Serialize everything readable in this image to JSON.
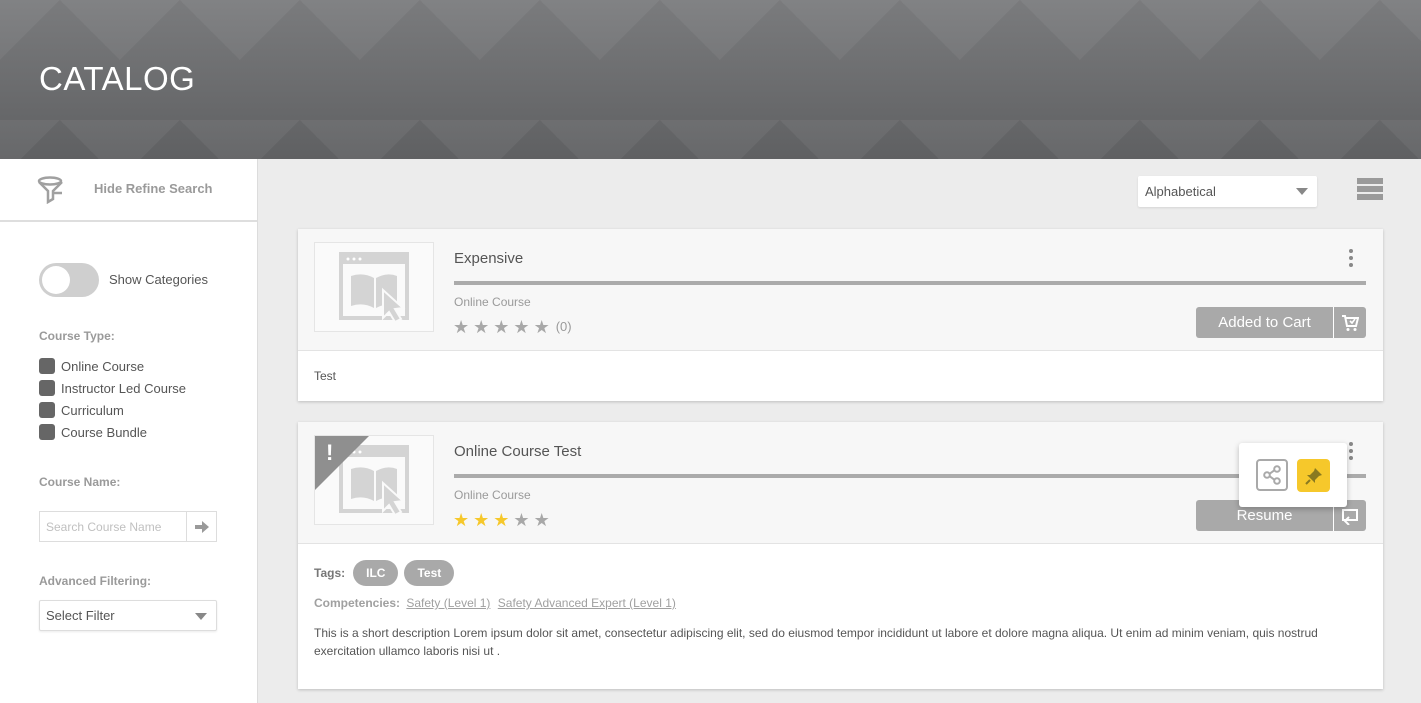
{
  "page": {
    "title": "CATALOG"
  },
  "sidebar": {
    "refine_label": "Hide Refine Search",
    "show_categories_label": "Show Categories",
    "course_type_label": "Course Type:",
    "course_types": [
      "Online Course",
      "Instructor Led Course",
      "Curriculum",
      "Course Bundle"
    ],
    "course_name_label": "Course Name:",
    "search_placeholder": "Search Course Name",
    "advanced_filtering_label": "Advanced Filtering:",
    "filter_value": "Select Filter"
  },
  "toolbar": {
    "sort_value": "Alphabetical"
  },
  "courses": [
    {
      "title": "Expensive",
      "type": "Online Course",
      "rating": 0,
      "rating_count": "(0)",
      "action_label": "Added to Cart",
      "description": "Test",
      "icon": "cart-icon"
    },
    {
      "title": "Online Course Test",
      "type": "Online Course",
      "rating": 3,
      "action_label": "Resume",
      "tags_label": "Tags:",
      "tags": [
        "ILC",
        "Test"
      ],
      "competencies_label": "Competencies:",
      "competencies": [
        "Safety (Level 1)",
        "Safety Advanced Expert (Level 1)"
      ],
      "alert_mark": "!",
      "description": "This is a short description Lorem ipsum dolor sit amet, consectetur adipiscing elit, sed do eiusmod tempor incididunt ut labore et dolore magna aliqua. Ut enim ad minim veniam, quis nostrud exercitation ullamco laboris nisi ut .",
      "icon": "resume-icon"
    }
  ],
  "colors": {
    "accent_yellow": "#f6c82b",
    "button_gray": "#a9a9a9",
    "banner_gray": "#6b6c6e"
  }
}
